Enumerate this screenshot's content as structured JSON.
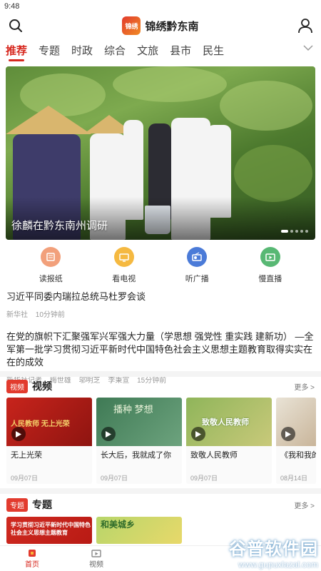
{
  "status": {
    "time": "9:48"
  },
  "header": {
    "logo_text": "锦绣",
    "title": "锦绣黔东南"
  },
  "tabs": [
    "推荐",
    "专题",
    "时政",
    "综合",
    "文旅",
    "县市",
    "民生"
  ],
  "hero": {
    "caption": "徐麟在黔东南州调研"
  },
  "shortcuts": [
    {
      "label": "读报纸",
      "icon": "newspaper-icon",
      "color": "#f2a07b"
    },
    {
      "label": "看电视",
      "icon": "tv-icon",
      "color": "#f5b941"
    },
    {
      "label": "听广播",
      "icon": "radio-icon",
      "color": "#4b7bd8"
    },
    {
      "label": "慢直播",
      "icon": "live-icon",
      "color": "#58b874"
    }
  ],
  "news": [
    {
      "title": "习近平同委内瑞拉总统马杜罗会谈",
      "source": "新华社",
      "time": "10分钟前"
    },
    {
      "title": "在党的旗帜下汇聚强军兴军强大力量（学思想 强党性 重实践 建新功） —全军第一批学习贯彻习近平新时代中国特色社会主义思想主题教育取得实实在在的成效",
      "source": "新华社记者",
      "authors": [
        "梅世雄",
        "邬明芝",
        "李秉宣"
      ],
      "time": "15分钟前"
    }
  ],
  "video_section": {
    "badge": "视频",
    "title": "视频",
    "more": "更多 >"
  },
  "videos": [
    {
      "title": "无上光荣",
      "date": "09月07日",
      "thumb_text": "人民教师  无上光荣"
    },
    {
      "title": "长大后，我就成了你",
      "date": "09月07日",
      "thumb_text": "播种 梦想"
    },
    {
      "title": "致敬人民教师",
      "date": "09月07日",
      "thumb_text": "致敬人民教师"
    },
    {
      "title": "《我和我的祖国》第期：宋李亲",
      "date": "08月14日",
      "thumb_text": ""
    }
  ],
  "topic_section": {
    "badge": "专题",
    "title": "专题",
    "more": "更多 >"
  },
  "topics": [
    {
      "text": "学习贯彻习近平新时代中国特色社会主义思想主题教育"
    },
    {
      "text": "和美城乡"
    }
  ],
  "bottom_nav": [
    {
      "label": "首页"
    },
    {
      "label": "视频"
    }
  ],
  "watermark": {
    "main": "谷普软件园",
    "sub": "www.gupuxlazal.com"
  }
}
